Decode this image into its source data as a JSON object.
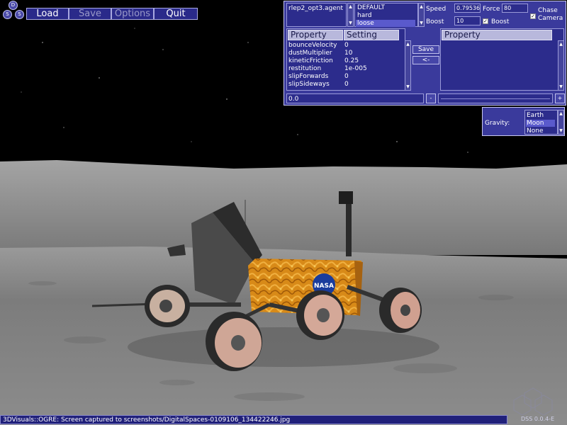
{
  "logo": {
    "letters": [
      "D",
      "S",
      "S"
    ]
  },
  "menu": {
    "load": "Load",
    "save": "Save",
    "options": "Options",
    "quit": "Quit"
  },
  "agent": {
    "filename": "rlep2_opt3.agent"
  },
  "terrain": {
    "options": [
      "DEFAULT",
      "hard",
      "loose"
    ],
    "selected": "loose"
  },
  "drive": {
    "speed_label": "Speed",
    "speed_value": "0.79536",
    "force_label": "Force",
    "force_value": "80",
    "boost_label": "Boost",
    "boost_value": "10",
    "boost_check_label": "Boost",
    "chase_label_1": "Chase",
    "chase_label_2": "Camera"
  },
  "props": {
    "header_property": "Property",
    "header_setting": "Setting",
    "rows": [
      {
        "name": "bounceVelocity",
        "value": "0"
      },
      {
        "name": "dustMultiplier",
        "value": "10"
      },
      {
        "name": "kineticFriction",
        "value": "0.25"
      },
      {
        "name": "restitution",
        "value": "1e-005"
      },
      {
        "name": "slipForwards",
        "value": "0"
      },
      {
        "name": "slipSideways",
        "value": "0"
      }
    ],
    "value_field": "0.0"
  },
  "actions": {
    "save": "Save",
    "back": "<-"
  },
  "right_props": {
    "header_property": "Property"
  },
  "gravity": {
    "label": "Gravity:",
    "options": [
      "Earth",
      "Moon",
      "None"
    ],
    "selected": "Moon"
  },
  "rover": {
    "badge": "NASA"
  },
  "status": {
    "message": "3DVisuals::OGRE: Screen captured to screenshots/DigitalSpaces-0109106_134422246.jpg"
  },
  "version": "DSS 0.0.4-E"
}
